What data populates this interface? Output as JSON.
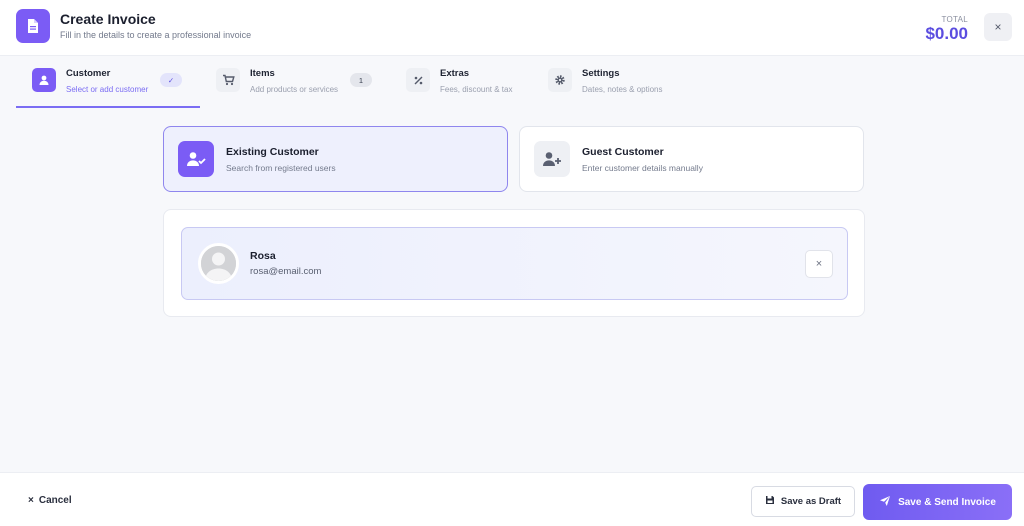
{
  "header": {
    "title": "Create Invoice",
    "subtitle": "Fill in the details to create a professional invoice",
    "total_label": "TOTAL",
    "total_value": "$0.00",
    "icon": "invoice-icon",
    "close_glyph": "×",
    "accent": "#7b5cf5"
  },
  "steps": [
    {
      "title": "Customer",
      "subtitle": "Select or add customer",
      "icon": "user-icon",
      "badge": "✓",
      "active": true
    },
    {
      "title": "Items",
      "subtitle": "Add products or services",
      "icon": "cart-icon",
      "badge": "1",
      "active": false
    },
    {
      "title": "Extras",
      "subtitle": "Fees, discount & tax",
      "icon": "percent-icon",
      "active": false
    },
    {
      "title": "Settings",
      "subtitle": "Dates, notes & options",
      "icon": "gear-icon",
      "active": false
    }
  ],
  "customer_types": [
    {
      "title": "Existing Customer",
      "subtitle": "Search from registered users",
      "icon": "user-check-icon",
      "selected": true
    },
    {
      "title": "Guest Customer",
      "subtitle": "Enter customer details manually",
      "icon": "user-plus-icon",
      "selected": false
    }
  ],
  "selected_customer": {
    "name": "Rosa",
    "email": "rosa@email.com",
    "remove_glyph": "×"
  },
  "footer": {
    "cancel_label": "Cancel",
    "cancel_glyph": "×",
    "draft_label": "Save as Draft",
    "send_label": "Save & Send Invoice",
    "send_color": "#7b5cf5"
  }
}
